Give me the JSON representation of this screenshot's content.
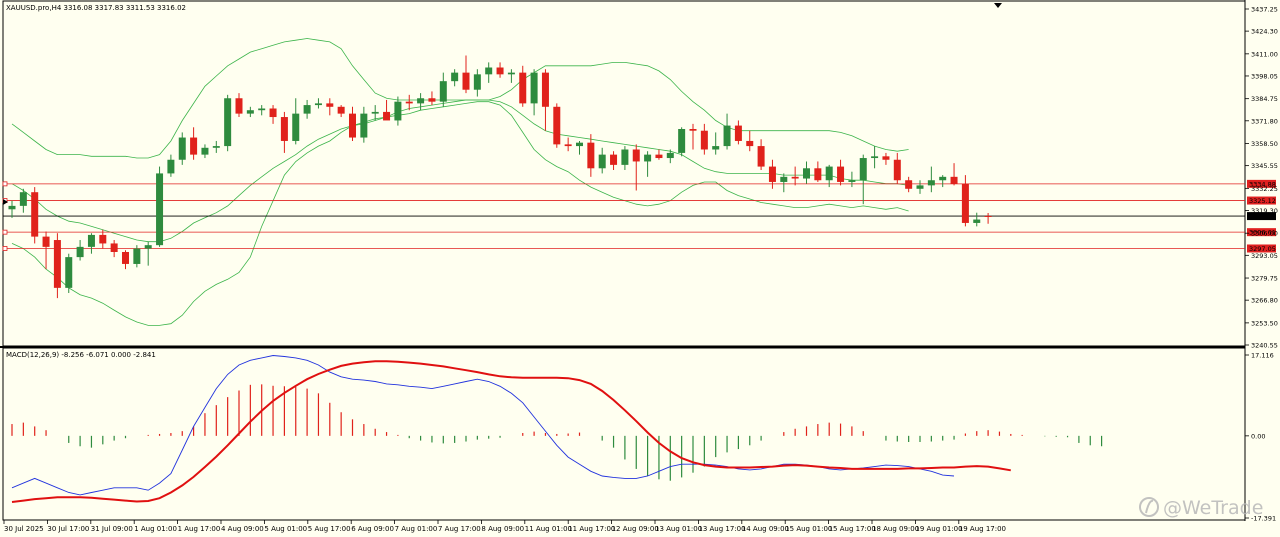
{
  "header": {
    "symbol_line": "XAUUSD.pro,H4  3316.08 3317.83 3311.53 3316.02",
    "indicator_line": "MACD(12,26,9) -8.256 -6.071 0.000 -2.841"
  },
  "watermark": {
    "text": "@WeTrade",
    "logo": "wetrade-logo-icon"
  },
  "colors": {
    "background": "#fffff0",
    "bull": "#2e8b3e",
    "bear": "#e0221b",
    "band": "#3cb44b",
    "level": "#e02020",
    "current": "#000000",
    "macd": "#2233dd",
    "signal": "#e01010"
  },
  "chart_data": [
    {
      "type": "candlestick",
      "symbol": "XAUUSD.pro",
      "timeframe": "H4",
      "ohlc_last": {
        "open": 3316.08,
        "high": 3317.83,
        "low": 3311.53,
        "close": 3316.02
      },
      "ylim": [
        3240.55,
        3437.25
      ],
      "price_ticks": [
        "3437.25",
        "3424.30",
        "3411.00",
        "3398.05",
        "3384.75",
        "3371.80",
        "3358.50",
        "3345.55",
        "3332.25",
        "3319.30",
        "3306.00",
        "3293.05",
        "3279.75",
        "3266.80",
        "3253.50",
        "3240.55"
      ],
      "level_lines": [
        {
          "label": "3334.88",
          "value": 3334.88
        },
        {
          "label": "3325.12",
          "value": 3325.12
        },
        {
          "label": "3306.61",
          "value": 3306.61
        },
        {
          "label": "3297.05",
          "value": 3297.05
        }
      ],
      "current_price": {
        "label": "3316.02",
        "value": 3316.02
      },
      "x_labels": [
        "30 Jul 2025",
        "30 Jul 17:00",
        "31 Jul 09:00",
        "1 Aug 01:00",
        "1 Aug 17:00",
        "4 Aug 09:00",
        "5 Aug 01:00",
        "5 Aug 17:00",
        "6 Aug 09:00",
        "7 Aug 01:00",
        "7 Aug 17:00",
        "8 Aug 09:00",
        "11 Aug 01:00",
        "11 Aug 17:00",
        "12 Aug 09:00",
        "13 Aug 01:00",
        "13 Aug 17:00",
        "14 Aug 09:00",
        "15 Aug 01:00",
        "15 Aug 17:00",
        "18 Aug 09:00",
        "19 Aug 01:00",
        "19 Aug 17:00"
      ],
      "candles": [
        [
          3320,
          3325,
          3315,
          3322
        ],
        [
          3322,
          3332,
          3318,
          3330
        ],
        [
          3330,
          3333,
          3300,
          3304
        ],
        [
          3304,
          3307,
          3285,
          3298
        ],
        [
          3302,
          3306,
          3268,
          3274
        ],
        [
          3274,
          3294,
          3271,
          3292
        ],
        [
          3292,
          3302,
          3290,
          3298
        ],
        [
          3298,
          3306,
          3294,
          3305
        ],
        [
          3305,
          3308,
          3297,
          3300
        ],
        [
          3300,
          3302,
          3292,
          3295
        ],
        [
          3295,
          3296,
          3285,
          3288
        ],
        [
          3288,
          3299,
          3286,
          3297
        ],
        [
          3297,
          3301,
          3287,
          3299
        ],
        [
          3299,
          3345,
          3298,
          3341
        ],
        [
          3341,
          3352,
          3339,
          3349
        ],
        [
          3349,
          3365,
          3346,
          3362
        ],
        [
          3362,
          3368,
          3349,
          3352
        ],
        [
          3352,
          3358,
          3350,
          3356
        ],
        [
          3356,
          3360,
          3353,
          3357
        ],
        [
          3357,
          3387,
          3354,
          3385
        ],
        [
          3385,
          3388,
          3374,
          3376
        ],
        [
          3376,
          3380,
          3374,
          3378
        ],
        [
          3378,
          3381,
          3375,
          3379
        ],
        [
          3379,
          3381,
          3370,
          3374
        ],
        [
          3374,
          3377,
          3353,
          3360
        ],
        [
          3360,
          3385,
          3358,
          3376
        ],
        [
          3376,
          3384,
          3373,
          3381
        ],
        [
          3381,
          3385,
          3379,
          3382
        ],
        [
          3382,
          3385,
          3375,
          3380
        ],
        [
          3380,
          3381,
          3374,
          3376
        ],
        [
          3376,
          3380,
          3360,
          3362
        ],
        [
          3362,
          3380,
          3359,
          3376
        ],
        [
          3376,
          3381,
          3372,
          3377
        ],
        [
          3377,
          3384,
          3373,
          3372
        ],
        [
          3372,
          3386,
          3369,
          3383
        ],
        [
          3383,
          3387,
          3378,
          3382
        ],
        [
          3382,
          3388,
          3378,
          3385
        ],
        [
          3385,
          3389,
          3381,
          3383
        ],
        [
          3383,
          3400,
          3380,
          3395
        ],
        [
          3395,
          3402,
          3392,
          3400
        ],
        [
          3400,
          3410,
          3388,
          3390
        ],
        [
          3390,
          3402,
          3386,
          3399
        ],
        [
          3399,
          3406,
          3394,
          3403
        ],
        [
          3403,
          3406,
          3397,
          3399
        ],
        [
          3399,
          3402,
          3394,
          3400
        ],
        [
          3400,
          3404,
          3380,
          3382
        ],
        [
          3382,
          3402,
          3375,
          3400
        ],
        [
          3400,
          3402,
          3366,
          3380
        ],
        [
          3380,
          3382,
          3356,
          3358
        ],
        [
          3358,
          3362,
          3354,
          3357
        ],
        [
          3357,
          3360,
          3352,
          3359
        ],
        [
          3359,
          3364,
          3339,
          3344
        ],
        [
          3344,
          3356,
          3341,
          3352
        ],
        [
          3352,
          3354,
          3343,
          3346
        ],
        [
          3346,
          3357,
          3343,
          3355
        ],
        [
          3355,
          3358,
          3331,
          3348
        ],
        [
          3348,
          3354,
          3339,
          3352
        ],
        [
          3352,
          3355,
          3349,
          3350
        ],
        [
          3350,
          3355,
          3347,
          3353
        ],
        [
          3353,
          3368,
          3351,
          3367
        ],
        [
          3367,
          3370,
          3355,
          3366
        ],
        [
          3366,
          3370,
          3352,
          3355
        ],
        [
          3355,
          3365,
          3352,
          3357
        ],
        [
          3357,
          3376,
          3355,
          3369
        ],
        [
          3369,
          3372,
          3358,
          3360
        ],
        [
          3360,
          3366,
          3354,
          3357
        ],
        [
          3357,
          3361,
          3343,
          3345
        ],
        [
          3345,
          3349,
          3332,
          3336
        ],
        [
          3336,
          3341,
          3330,
          3339
        ],
        [
          3339,
          3345,
          3334,
          3338
        ],
        [
          3338,
          3348,
          3335,
          3344
        ],
        [
          3344,
          3348,
          3336,
          3337
        ],
        [
          3337,
          3346,
          3333,
          3345
        ],
        [
          3345,
          3349,
          3334,
          3336
        ],
        [
          3336,
          3342,
          3333,
          3337
        ],
        [
          3337,
          3352,
          3323,
          3350
        ],
        [
          3350,
          3357,
          3344,
          3351
        ],
        [
          3351,
          3353,
          3346,
          3349
        ],
        [
          3349,
          3353,
          3335,
          3337
        ],
        [
          3337,
          3339,
          3330,
          3332
        ],
        [
          3332,
          3337,
          3329,
          3334
        ],
        [
          3334,
          3345,
          3330,
          3337
        ],
        [
          3337,
          3340,
          3333,
          3339
        ],
        [
          3339,
          3347,
          3334,
          3335
        ],
        [
          3335,
          3340,
          3310,
          3312
        ],
        [
          3312,
          3318,
          3310,
          3314
        ],
        [
          3316.08,
          3317.83,
          3311.53,
          3316.02
        ]
      ],
      "bollinger": {
        "upper": [
          3370,
          3365,
          3360,
          3355,
          3352,
          3352,
          3352,
          3351,
          3351,
          3351,
          3351,
          3350,
          3350,
          3352,
          3360,
          3372,
          3382,
          3392,
          3398,
          3404,
          3408,
          3412,
          3414,
          3416,
          3418,
          3419,
          3420,
          3419,
          3418,
          3414,
          3404,
          3396,
          3388,
          3385,
          3384,
          3384,
          3384,
          3384,
          3384,
          3384,
          3384,
          3384,
          3384,
          3386,
          3390,
          3396,
          3400,
          3404,
          3404,
          3404,
          3404,
          3404,
          3405,
          3406,
          3406,
          3405,
          3404,
          3401,
          3396,
          3389,
          3383,
          3378,
          3372,
          3368,
          3366,
          3366,
          3366,
          3366,
          3366,
          3366,
          3366,
          3366,
          3366,
          3365,
          3363,
          3360,
          3357,
          3355,
          3354,
          3355
        ],
        "middle": [
          3335,
          3331,
          3326,
          3320,
          3316,
          3313,
          3312,
          3310,
          3308,
          3306,
          3304,
          3302,
          3301,
          3301,
          3303,
          3307,
          3312,
          3315,
          3318,
          3322,
          3328,
          3334,
          3339,
          3344,
          3348,
          3352,
          3357,
          3361,
          3364,
          3367,
          3369,
          3370,
          3372,
          3374,
          3377,
          3379,
          3380,
          3381,
          3382,
          3383,
          3384,
          3384,
          3384,
          3383,
          3380,
          3375,
          3370,
          3366,
          3364,
          3363,
          3362,
          3361,
          3360,
          3359,
          3358,
          3357,
          3356,
          3355,
          3354,
          3352,
          3348,
          3344,
          3342,
          3341,
          3341,
          3341,
          3341,
          3341,
          3340,
          3340,
          3340,
          3340,
          3340,
          3338,
          3337,
          3337,
          3336,
          3335,
          3335,
          3334
        ],
        "lower": [
          3300,
          3297,
          3292,
          3285,
          3280,
          3274,
          3270,
          3268,
          3265,
          3261,
          3257,
          3254,
          3252,
          3252,
          3253,
          3258,
          3266,
          3272,
          3276,
          3279,
          3283,
          3292,
          3310,
          3325,
          3340,
          3348,
          3353,
          3357,
          3360,
          3365,
          3369,
          3371,
          3373,
          3374,
          3375,
          3376,
          3378,
          3379,
          3380,
          3381,
          3382,
          3383,
          3383,
          3381,
          3375,
          3365,
          3355,
          3349,
          3345,
          3342,
          3337,
          3333,
          3330,
          3327,
          3325,
          3323,
          3322,
          3323,
          3325,
          3330,
          3334,
          3336,
          3336,
          3331,
          3328,
          3326,
          3324,
          3323,
          3322,
          3321,
          3321,
          3322,
          3323,
          3322,
          3321,
          3322,
          3321,
          3320,
          3321,
          3319
        ]
      }
    },
    {
      "type": "macd",
      "params": "MACD(12,26,9)",
      "values_last": {
        "main": -8.256,
        "signal": -6.071,
        "zero": 0.0,
        "histogram": -2.841
      },
      "ylim": [
        -17.391,
        17.116
      ],
      "y_ticks": [
        "17.116",
        "0.00",
        "-17.391"
      ],
      "histogram": [
        2.5,
        2.8,
        2.0,
        1.2,
        0.0,
        -1.5,
        -2.2,
        -2.5,
        -1.8,
        -1.0,
        -0.5,
        0.0,
        0.2,
        0.4,
        0.6,
        1.0,
        2.0,
        4.8,
        6.5,
        8.2,
        9.6,
        10.8,
        10.9,
        10.6,
        10.5,
        10.4,
        10.0,
        9.0,
        7.0,
        5.0,
        3.5,
        2.5,
        1.5,
        0.8,
        0.2,
        -0.5,
        -1.0,
        -1.4,
        -1.6,
        -1.5,
        -1.2,
        -0.8,
        -0.6,
        -0.4,
        0.0,
        0.6,
        0.9,
        0.6,
        0.4,
        0.5,
        0.7,
        0.0,
        -1.0,
        -2.5,
        -5.0,
        -7.0,
        -8.5,
        -9.2,
        -9.5,
        -8.8,
        -7.8,
        -6.5,
        -4.5,
        -3.5,
        -2.8,
        -2.0,
        -1.0,
        0.0,
        0.8,
        1.5,
        2.0,
        2.5,
        2.8,
        2.6,
        2.0,
        1.0,
        0.0,
        -1.0,
        -1.2,
        -1.3,
        -1.3,
        -1.2,
        -1.0,
        -0.8,
        0.5,
        1.0,
        1.2,
        0.9,
        0.4,
        0.2,
        0.0,
        -0.1,
        -0.2,
        -0.3,
        -1.5,
        -2.0,
        -2.2
      ],
      "main": [
        -11,
        -10,
        -9,
        -10,
        -11,
        -12,
        -12.5,
        -12,
        -11.5,
        -11,
        -11,
        -11,
        -11.5,
        -10,
        -8,
        -3,
        2,
        6,
        10,
        13,
        15,
        16,
        16.5,
        17,
        16.8,
        16.5,
        16,
        15,
        13.5,
        12.5,
        12,
        11.8,
        11.5,
        11,
        10.8,
        10.5,
        10.3,
        10,
        10.5,
        11,
        11.5,
        12,
        11.5,
        10.5,
        9,
        7,
        4,
        1,
        -2,
        -4.5,
        -6,
        -7.5,
        -8.5,
        -8.8,
        -9,
        -9,
        -8.5,
        -7.5,
        -6.5,
        -6,
        -6,
        -6,
        -6.2,
        -6.5,
        -7,
        -7.2,
        -7,
        -6.5,
        -6,
        -6,
        -6.2,
        -6.5,
        -7,
        -7.2,
        -7,
        -6.8,
        -6.5,
        -6.2,
        -6.3,
        -6.5,
        -7,
        -7.5,
        -8.3,
        -8.5
      ],
      "signal": [
        -14,
        -13.7,
        -13.4,
        -13.2,
        -13,
        -13,
        -13,
        -13.1,
        -13.3,
        -13.5,
        -13.7,
        -13.9,
        -13.8,
        -13.2,
        -12,
        -10.5,
        -8.7,
        -6.6,
        -4.4,
        -2,
        0.5,
        3,
        5.3,
        7.4,
        9.1,
        10.6,
        12,
        13.1,
        14,
        14.8,
        15.3,
        15.6,
        15.8,
        15.8,
        15.7,
        15.5,
        15.3,
        15,
        14.7,
        14.3,
        13.9,
        13.5,
        13,
        12.6,
        12.4,
        12.3,
        12.3,
        12.3,
        12.3,
        12.2,
        11.8,
        11,
        9.5,
        7.6,
        5.4,
        3.1,
        0.7,
        -1.5,
        -3.3,
        -4.7,
        -5.6,
        -6.2,
        -6.5,
        -6.7,
        -6.7,
        -6.7,
        -6.6,
        -6.5,
        -6.3,
        -6.2,
        -6.3,
        -6.5,
        -6.7,
        -6.8,
        -7,
        -7,
        -7,
        -7,
        -7,
        -6.9,
        -6.9,
        -6.8,
        -6.7,
        -6.7,
        -6.5,
        -6.4,
        -6.5,
        -6.9,
        -7.3
      ]
    }
  ]
}
